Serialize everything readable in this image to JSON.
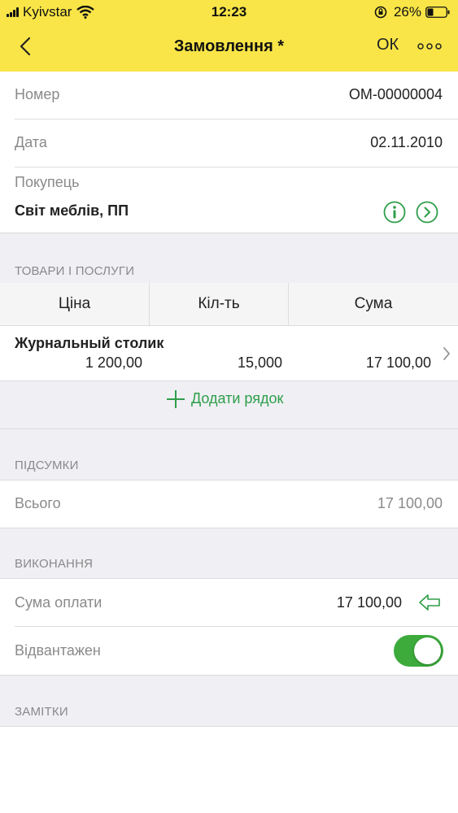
{
  "status_bar": {
    "carrier": "Kyivstar",
    "time": "12:23",
    "battery": "26%"
  },
  "nav": {
    "title": "Замовлення *",
    "ok_label": "ОК"
  },
  "header_fields": {
    "number": {
      "label": "Номер",
      "value": "ОМ-00000004"
    },
    "date": {
      "label": "Дата",
      "value": "02.11.2010"
    },
    "buyer": {
      "label": "Покупець",
      "value": "Світ меблів, ПП"
    }
  },
  "goods": {
    "section_title": "ТОВАРИ І ПОСЛУГИ",
    "columns": [
      "Ціна",
      "Кіл-ть",
      "Сума"
    ],
    "rows": [
      {
        "name": "Журнальный столик",
        "price": "1 200,00",
        "qty": "15,000",
        "sum": "17 100,00"
      }
    ],
    "add_row_label": "Додати рядок"
  },
  "totals": {
    "section_title": "ПІДСУМКИ",
    "total_label": "Всього",
    "total_value": "17 100,00"
  },
  "execution": {
    "section_title": "ВИКОНАННЯ",
    "payment_label": "Сума оплати",
    "payment_value": "17 100,00",
    "shipped_label": "Відвантажен",
    "shipped_on": true
  },
  "notes": {
    "section_title": "ЗАМІТКИ"
  },
  "colors": {
    "accent_bar": "#f9e547",
    "green": "#2e9e4a",
    "toggle_on": "#3cab3c"
  }
}
